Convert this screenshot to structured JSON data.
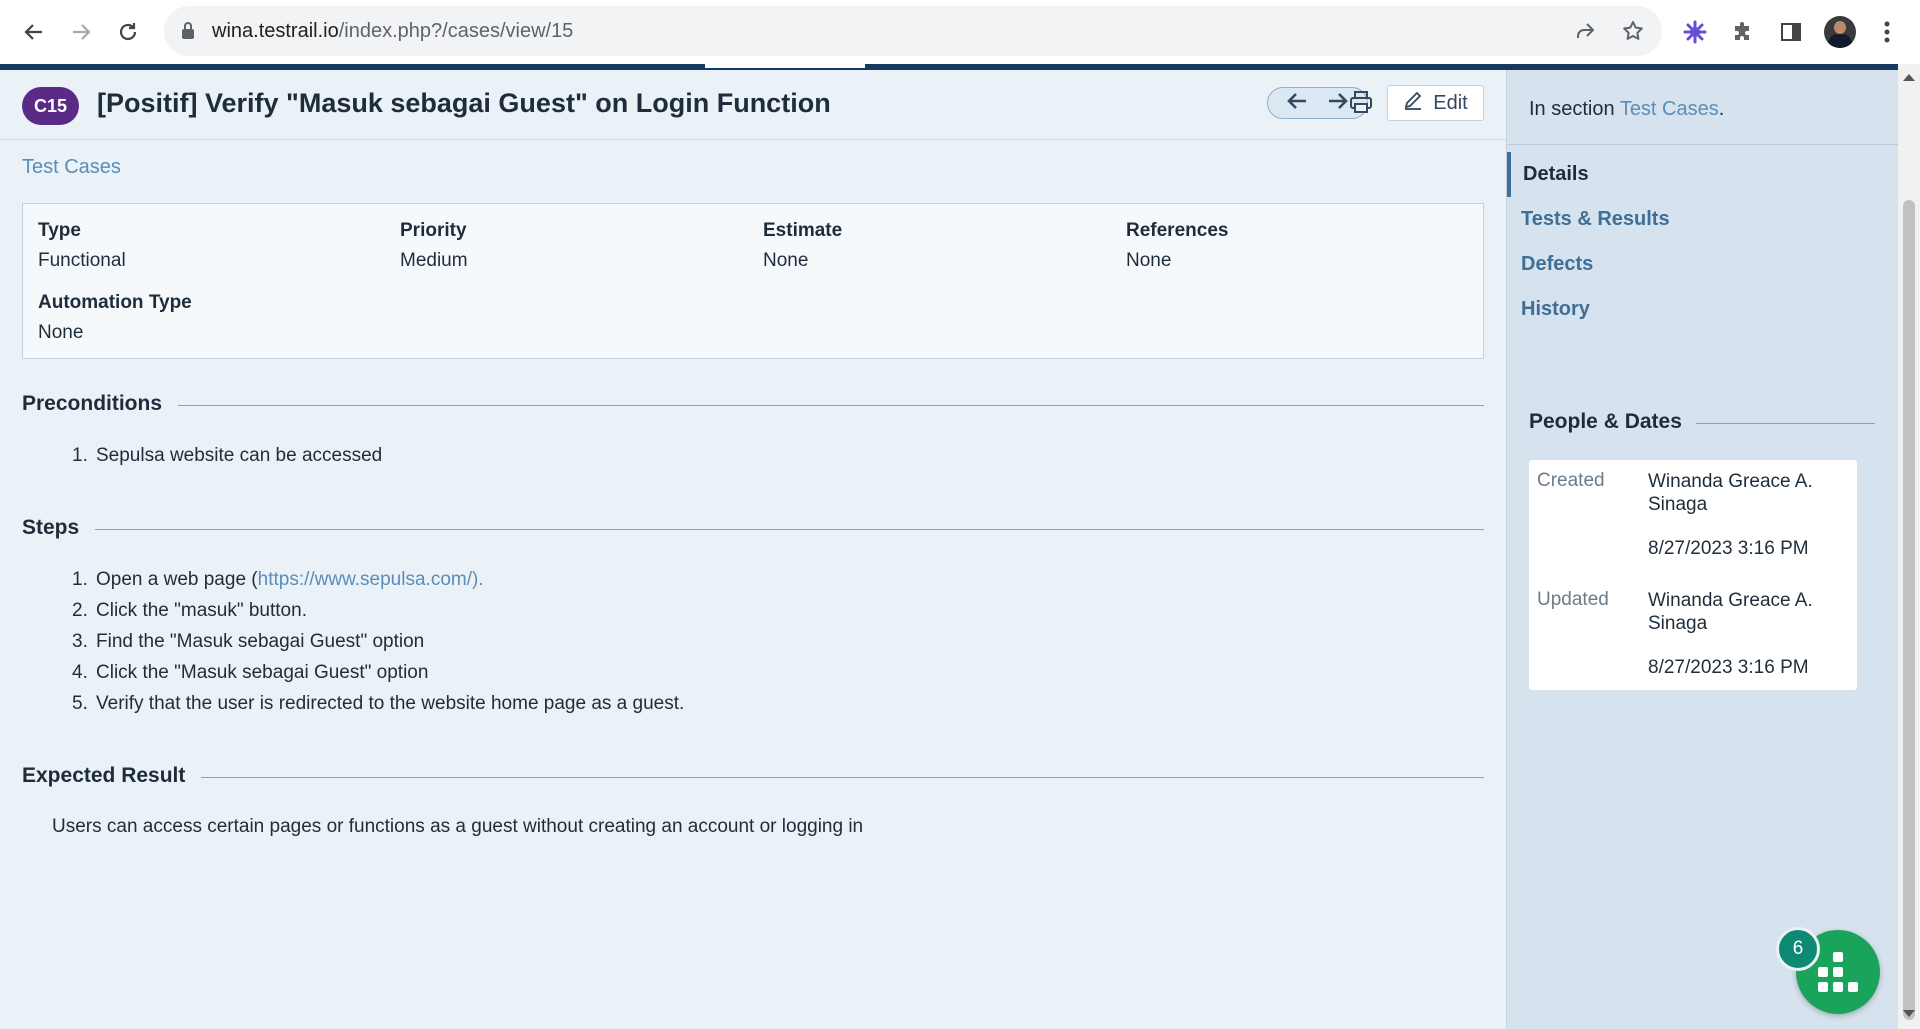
{
  "browser": {
    "url_host": "wina.testrail.io",
    "url_path": "/index.php?/cases/view/15"
  },
  "case": {
    "id": "C15",
    "title": "[Positif] Verify \"Masuk sebagai Guest\" on Login Function",
    "edit_label": "Edit",
    "breadcrumb": "Test Cases"
  },
  "fields": {
    "type_label": "Type",
    "type_value": "Functional",
    "priority_label": "Priority",
    "priority_value": "Medium",
    "estimate_label": "Estimate",
    "estimate_value": "None",
    "references_label": "References",
    "references_value": "None",
    "automation_label": "Automation Type",
    "automation_value": "None"
  },
  "preconditions": {
    "title": "Preconditions",
    "items": [
      "Sepulsa website can be accessed"
    ]
  },
  "steps": {
    "title": "Steps",
    "step1_prefix": "Open a web page (",
    "step1_link": "https://www.sepulsa.com/).",
    "items": [
      "Click the \"masuk\" button.",
      "Find the \"Masuk sebagai Guest\" option",
      "Click the \"Masuk sebagai Guest\" option",
      "Verify that the user is redirected to the website home page as a guest."
    ]
  },
  "expected": {
    "title": "Expected Result",
    "text": "Users can access certain pages or functions as a guest without creating an account or logging in"
  },
  "sidebar": {
    "in_section_prefix": "In section ",
    "in_section_link": "Test Cases",
    "in_section_suffix": ".",
    "nav": [
      "Details",
      "Tests & Results",
      "Defects",
      "History"
    ],
    "people_title": "People & Dates",
    "created_label": "Created",
    "created_by": "Winanda Greace A. Sinaga",
    "created_date": "8/27/2023 3:16 PM",
    "updated_label": "Updated",
    "updated_by": "Winanda Greace A. Sinaga",
    "updated_date": "8/27/2023 3:16 PM"
  },
  "widget": {
    "badge_count": "6"
  },
  "colors": {
    "case_badge": "#5b2a86",
    "link": "#5b8db8",
    "widget": "#1aa35a"
  }
}
